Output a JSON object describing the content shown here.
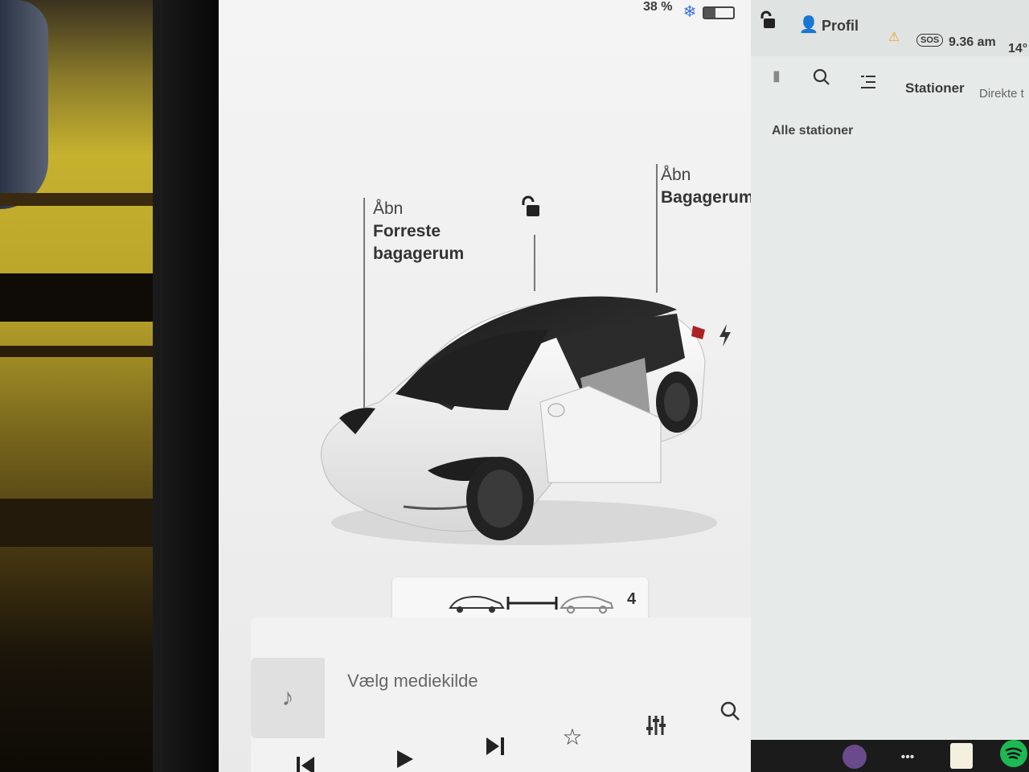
{
  "status_bar": {
    "battery_percent": "38 %",
    "battery_level": 0.38,
    "snowflake_icon": "snowflake-icon",
    "profile_label": "Profil",
    "sos_label": "SOS",
    "time": "9.36 am",
    "temperature": "14°"
  },
  "car_controls": {
    "front_trunk_action": "Åbn",
    "front_trunk_label_1": "Forreste",
    "front_trunk_label_2": "bagagerum",
    "trunk_action": "Åbn",
    "trunk_label": "Bagagerum",
    "wiper_speed": "4"
  },
  "nav_panel": {
    "tab_stations": "Stationer",
    "tab_direct": "Direkte t",
    "all_stations": "Alle stationer"
  },
  "media": {
    "source_placeholder": "Vælg mediekilde"
  },
  "colors": {
    "screen_bg": "#ececec",
    "right_panel_bg": "#e6ebea",
    "spotify_green": "#1db954",
    "lightning_color": "#333333"
  }
}
